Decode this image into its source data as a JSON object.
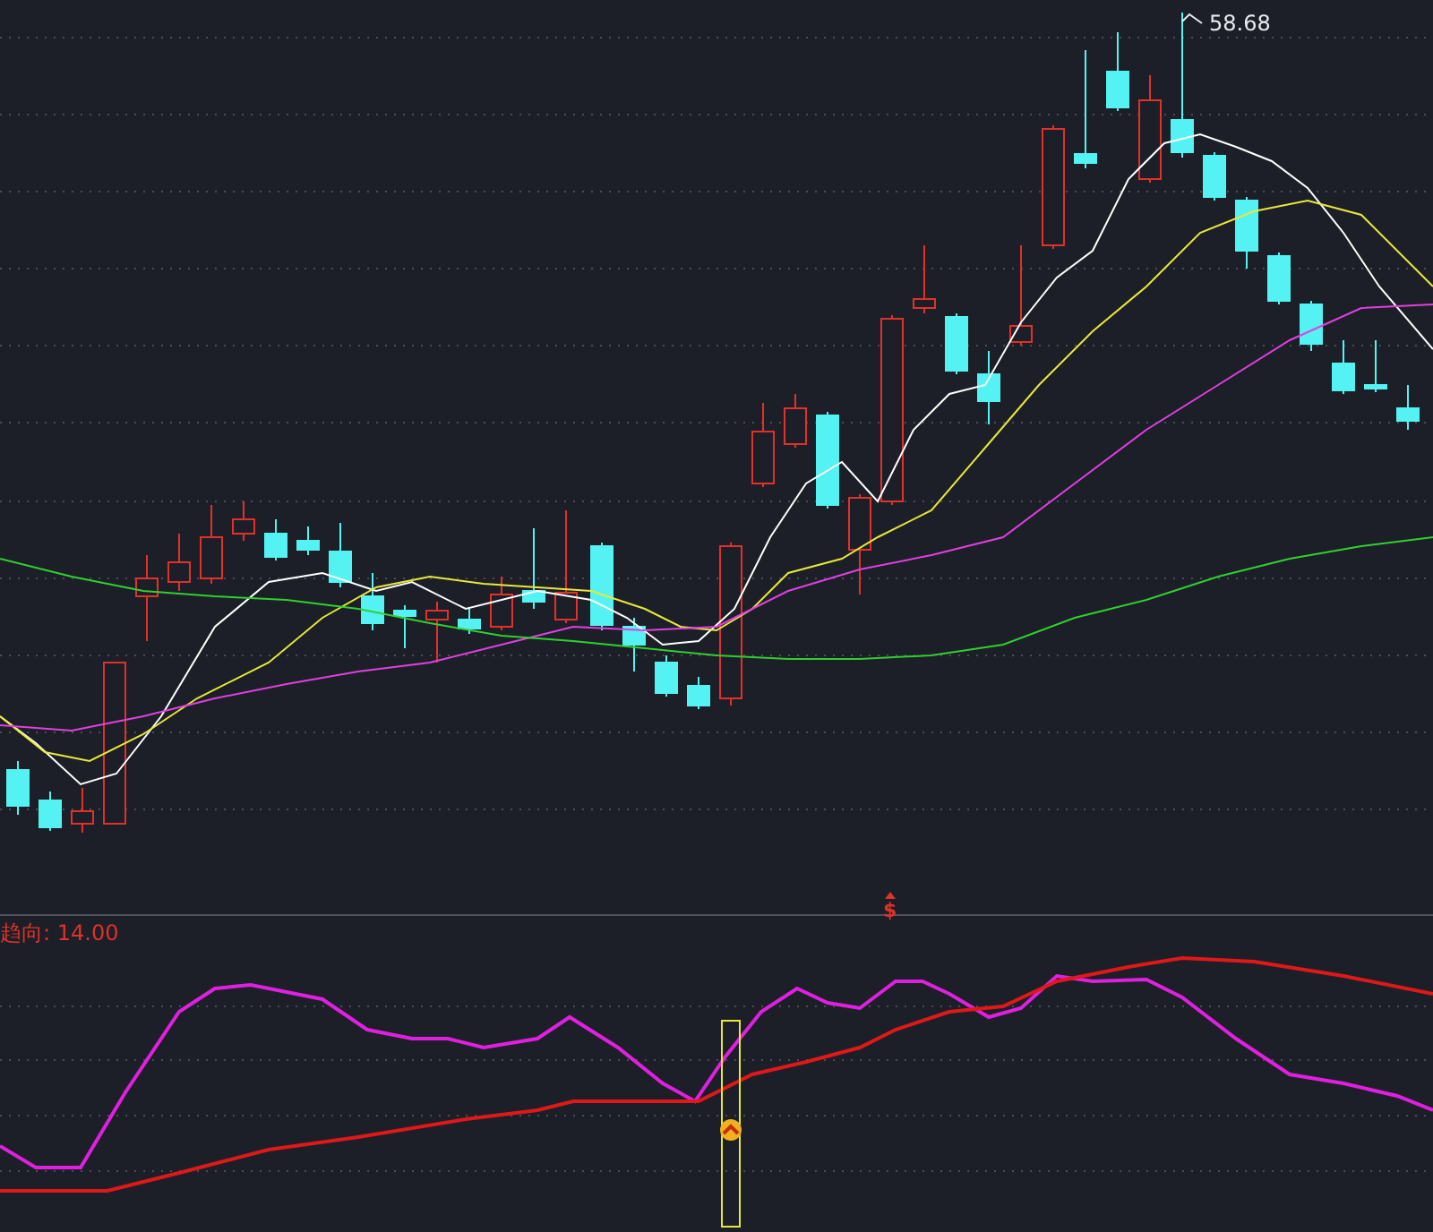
{
  "price_chart": {
    "high_label": "58.68",
    "signal_mark": "$"
  },
  "indicator": {
    "label": "趋向: 14.00"
  }
}
